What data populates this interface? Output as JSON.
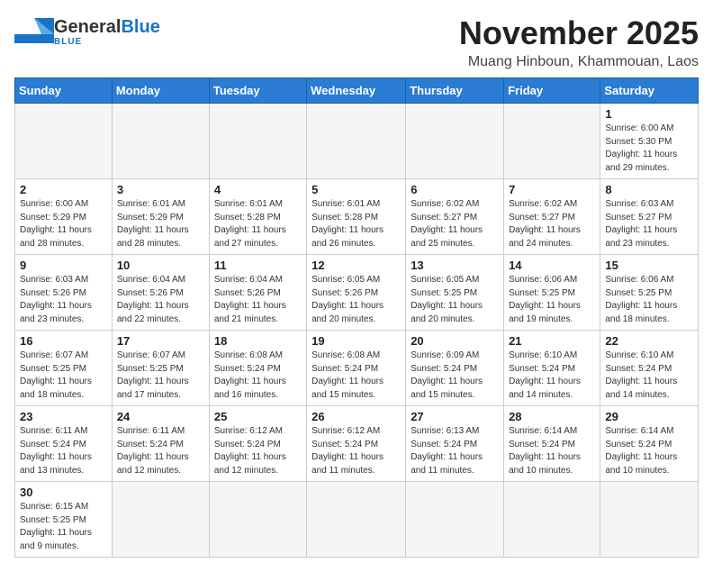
{
  "header": {
    "logo_text_general": "General",
    "logo_text_blue": "Blue",
    "month_title": "November 2025",
    "location": "Muang Hinboun, Khammouan, Laos"
  },
  "days_of_week": [
    "Sunday",
    "Monday",
    "Tuesday",
    "Wednesday",
    "Thursday",
    "Friday",
    "Saturday"
  ],
  "weeks": [
    {
      "days": [
        {
          "num": "",
          "info": ""
        },
        {
          "num": "",
          "info": ""
        },
        {
          "num": "",
          "info": ""
        },
        {
          "num": "",
          "info": ""
        },
        {
          "num": "",
          "info": ""
        },
        {
          "num": "",
          "info": ""
        },
        {
          "num": "1",
          "info": "Sunrise: 6:00 AM\nSunset: 5:30 PM\nDaylight: 11 hours\nand 29 minutes."
        }
      ]
    },
    {
      "days": [
        {
          "num": "2",
          "info": "Sunrise: 6:00 AM\nSunset: 5:29 PM\nDaylight: 11 hours\nand 28 minutes."
        },
        {
          "num": "3",
          "info": "Sunrise: 6:01 AM\nSunset: 5:29 PM\nDaylight: 11 hours\nand 28 minutes."
        },
        {
          "num": "4",
          "info": "Sunrise: 6:01 AM\nSunset: 5:28 PM\nDaylight: 11 hours\nand 27 minutes."
        },
        {
          "num": "5",
          "info": "Sunrise: 6:01 AM\nSunset: 5:28 PM\nDaylight: 11 hours\nand 26 minutes."
        },
        {
          "num": "6",
          "info": "Sunrise: 6:02 AM\nSunset: 5:27 PM\nDaylight: 11 hours\nand 25 minutes."
        },
        {
          "num": "7",
          "info": "Sunrise: 6:02 AM\nSunset: 5:27 PM\nDaylight: 11 hours\nand 24 minutes."
        },
        {
          "num": "8",
          "info": "Sunrise: 6:03 AM\nSunset: 5:27 PM\nDaylight: 11 hours\nand 23 minutes."
        }
      ]
    },
    {
      "days": [
        {
          "num": "9",
          "info": "Sunrise: 6:03 AM\nSunset: 5:26 PM\nDaylight: 11 hours\nand 23 minutes."
        },
        {
          "num": "10",
          "info": "Sunrise: 6:04 AM\nSunset: 5:26 PM\nDaylight: 11 hours\nand 22 minutes."
        },
        {
          "num": "11",
          "info": "Sunrise: 6:04 AM\nSunset: 5:26 PM\nDaylight: 11 hours\nand 21 minutes."
        },
        {
          "num": "12",
          "info": "Sunrise: 6:05 AM\nSunset: 5:26 PM\nDaylight: 11 hours\nand 20 minutes."
        },
        {
          "num": "13",
          "info": "Sunrise: 6:05 AM\nSunset: 5:25 PM\nDaylight: 11 hours\nand 20 minutes."
        },
        {
          "num": "14",
          "info": "Sunrise: 6:06 AM\nSunset: 5:25 PM\nDaylight: 11 hours\nand 19 minutes."
        },
        {
          "num": "15",
          "info": "Sunrise: 6:06 AM\nSunset: 5:25 PM\nDaylight: 11 hours\nand 18 minutes."
        }
      ]
    },
    {
      "days": [
        {
          "num": "16",
          "info": "Sunrise: 6:07 AM\nSunset: 5:25 PM\nDaylight: 11 hours\nand 18 minutes."
        },
        {
          "num": "17",
          "info": "Sunrise: 6:07 AM\nSunset: 5:25 PM\nDaylight: 11 hours\nand 17 minutes."
        },
        {
          "num": "18",
          "info": "Sunrise: 6:08 AM\nSunset: 5:24 PM\nDaylight: 11 hours\nand 16 minutes."
        },
        {
          "num": "19",
          "info": "Sunrise: 6:08 AM\nSunset: 5:24 PM\nDaylight: 11 hours\nand 15 minutes."
        },
        {
          "num": "20",
          "info": "Sunrise: 6:09 AM\nSunset: 5:24 PM\nDaylight: 11 hours\nand 15 minutes."
        },
        {
          "num": "21",
          "info": "Sunrise: 6:10 AM\nSunset: 5:24 PM\nDaylight: 11 hours\nand 14 minutes."
        },
        {
          "num": "22",
          "info": "Sunrise: 6:10 AM\nSunset: 5:24 PM\nDaylight: 11 hours\nand 14 minutes."
        }
      ]
    },
    {
      "days": [
        {
          "num": "23",
          "info": "Sunrise: 6:11 AM\nSunset: 5:24 PM\nDaylight: 11 hours\nand 13 minutes."
        },
        {
          "num": "24",
          "info": "Sunrise: 6:11 AM\nSunset: 5:24 PM\nDaylight: 11 hours\nand 12 minutes."
        },
        {
          "num": "25",
          "info": "Sunrise: 6:12 AM\nSunset: 5:24 PM\nDaylight: 11 hours\nand 12 minutes."
        },
        {
          "num": "26",
          "info": "Sunrise: 6:12 AM\nSunset: 5:24 PM\nDaylight: 11 hours\nand 11 minutes."
        },
        {
          "num": "27",
          "info": "Sunrise: 6:13 AM\nSunset: 5:24 PM\nDaylight: 11 hours\nand 11 minutes."
        },
        {
          "num": "28",
          "info": "Sunrise: 6:14 AM\nSunset: 5:24 PM\nDaylight: 11 hours\nand 10 minutes."
        },
        {
          "num": "29",
          "info": "Sunrise: 6:14 AM\nSunset: 5:24 PM\nDaylight: 11 hours\nand 10 minutes."
        }
      ]
    },
    {
      "days": [
        {
          "num": "30",
          "info": "Sunrise: 6:15 AM\nSunset: 5:25 PM\nDaylight: 11 hours\nand 9 minutes."
        },
        {
          "num": "",
          "info": ""
        },
        {
          "num": "",
          "info": ""
        },
        {
          "num": "",
          "info": ""
        },
        {
          "num": "",
          "info": ""
        },
        {
          "num": "",
          "info": ""
        },
        {
          "num": "",
          "info": ""
        }
      ]
    }
  ]
}
